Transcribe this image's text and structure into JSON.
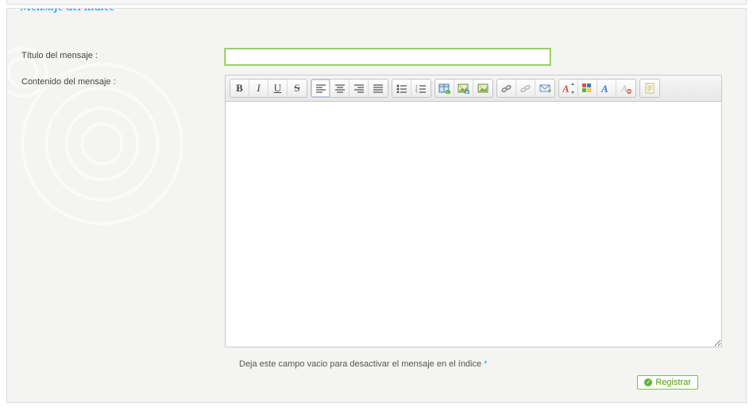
{
  "panel": {
    "title": "Mensaje del índice"
  },
  "fields": {
    "title_label": "Título del mensaje :",
    "title_value": "",
    "content_label": "Contenido del mensaje :"
  },
  "toolbar": {
    "groups": [
      {
        "buttons": [
          "bold",
          "italic",
          "underline",
          "strike"
        ]
      },
      {
        "buttons": [
          "align-left",
          "align-center",
          "align-right",
          "align-justify"
        ]
      },
      {
        "buttons": [
          "unordered-list",
          "ordered-list"
        ]
      },
      {
        "buttons": [
          "table-insert",
          "image-host",
          "image-insert"
        ]
      },
      {
        "buttons": [
          "link",
          "unlink",
          "mail"
        ]
      },
      {
        "buttons": [
          "font-size",
          "font-color",
          "font-family",
          "remove-format"
        ]
      },
      {
        "buttons": [
          "source"
        ]
      }
    ],
    "icons": {
      "bold": "B",
      "italic": "I",
      "underline": "U",
      "strike": "S"
    }
  },
  "editor": {
    "value": ""
  },
  "hint": {
    "text": "Deja este campo vacio para desactivar el mensaje en el índice ",
    "marker": "*"
  },
  "actions": {
    "register": "Registrar"
  }
}
